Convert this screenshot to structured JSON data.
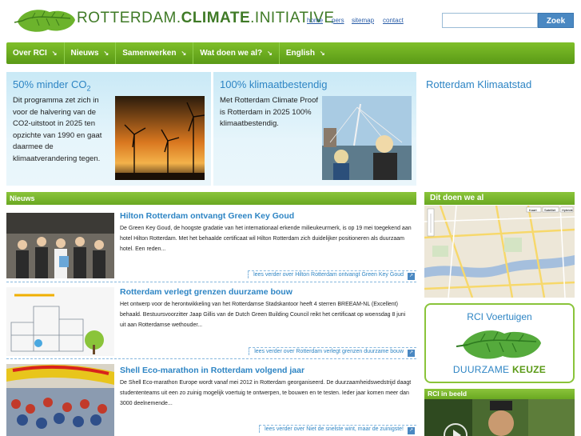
{
  "header": {
    "logo_word_1": "ROTTERDAM.",
    "logo_word_2": "CLIMATE",
    "logo_word_3": ".INITIATIVE",
    "links": [
      "home",
      "pers",
      "sitemap",
      "contact"
    ],
    "search_button": "Zoek",
    "search_value": ""
  },
  "nav": {
    "items": [
      "Over RCI",
      "Nieuws",
      "Samenwerken",
      "Wat doen we al?",
      "English"
    ],
    "chevron_icon": "arrow-down-right-icon"
  },
  "hero": {
    "left": {
      "title_main": "50% minder CO",
      "title_sub": "2",
      "text": "Dit programma zet zich in voor de halvering van de CO2-uitstoot in 2025 ten opzichte van 1990 en gaat daarmee de klimaatverandering tegen."
    },
    "mid": {
      "title": "100% klimaatbestendig",
      "text": "Met Rotterdam Climate Proof is Rotterdam in 2025 100% klimaatbestendig."
    },
    "right": {
      "title": "Rotterdam Klimaatstad"
    }
  },
  "news": {
    "bar_title": "Nieuws",
    "items": [
      {
        "title": "Hilton Rotterdam ontvangt Green Key Goud",
        "body": "De Green Key Goud, de hoogste gradatie van het internationaal erkende milieukeurmerk, is op 19 mei toegekend aan hotel Hilton Rotterdam. Met het behaalde certificaat wil Hilton Rotterdam zich duidelijker positioneren als duurzaam hotel. Een reden...",
        "more": "lees verder over Hilton Rotterdam ontvangt Green Key Goud"
      },
      {
        "title": "Rotterdam verlegt grenzen duurzame bouw",
        "body": "Het ontwerp voor de herontwikkeling van het Rotterdamse Stadskantoor heeft 4 sterren BREEAM-NL (Excellent) behaald. Bestuursvoorzitter Jaap Gillis van de Dutch Green Building Council reikt het certificaat op woensdag 8 juni uit aan Rotterdamse wethouder...",
        "more": "lees verder over Rotterdam verlegt grenzen duurzame bouw"
      },
      {
        "title": "Shell Eco-marathon in Rotterdam volgend jaar",
        "body": "De Shell Eco-marathon Europe wordt vanaf mei 2012 in Rotterdam georganiseerd.  De duurzaamheidswedstrijd daagt studententeams uit een zo zuinig mogelijk voertuig te ontwerpen, te bouwen en te testen. Ieder jaar komen meer dan 3000 deelnemende...",
        "more": "lees verder over Niet de snelste wint, maar de zuinigste!"
      }
    ]
  },
  "sidebar": {
    "doen_title": "Dit doen we al",
    "map_controls": [
      "Kaart",
      "Satelliet",
      "Hybride"
    ],
    "voertuig_title": "RCI Voertuigen",
    "voertuig_sub_1": "DUURZAME ",
    "voertuig_sub_2": "KEUZE",
    "beeld_title": "RCI in beeld"
  },
  "colors": {
    "green": "#6aa822",
    "blue": "#2e85c4",
    "sky": "#c9e9f6"
  }
}
